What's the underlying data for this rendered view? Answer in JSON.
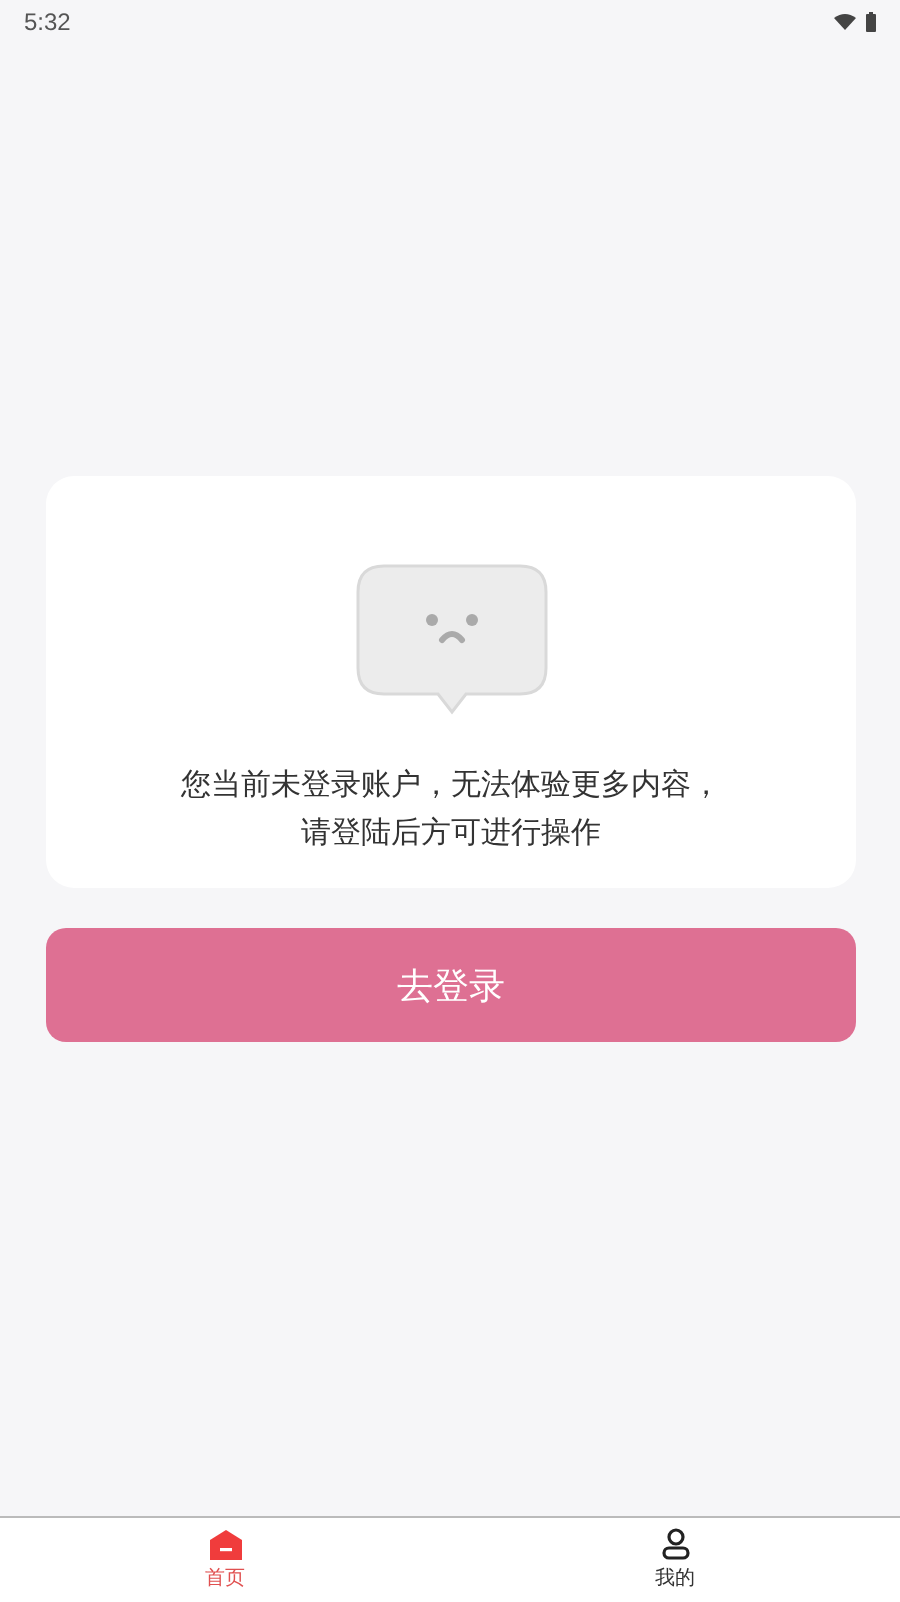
{
  "status_bar": {
    "time": "5:32"
  },
  "empty_state": {
    "message_lines": [
      "您当前未登录账户，无法体验更多内容，",
      "请登陆后方可进行操作"
    ]
  },
  "login_button": {
    "label": "去登录"
  },
  "bottom_nav": [
    {
      "label": "首页",
      "selected": true,
      "kind": "home"
    },
    {
      "label": "我的",
      "selected": false,
      "kind": "profile"
    }
  ]
}
